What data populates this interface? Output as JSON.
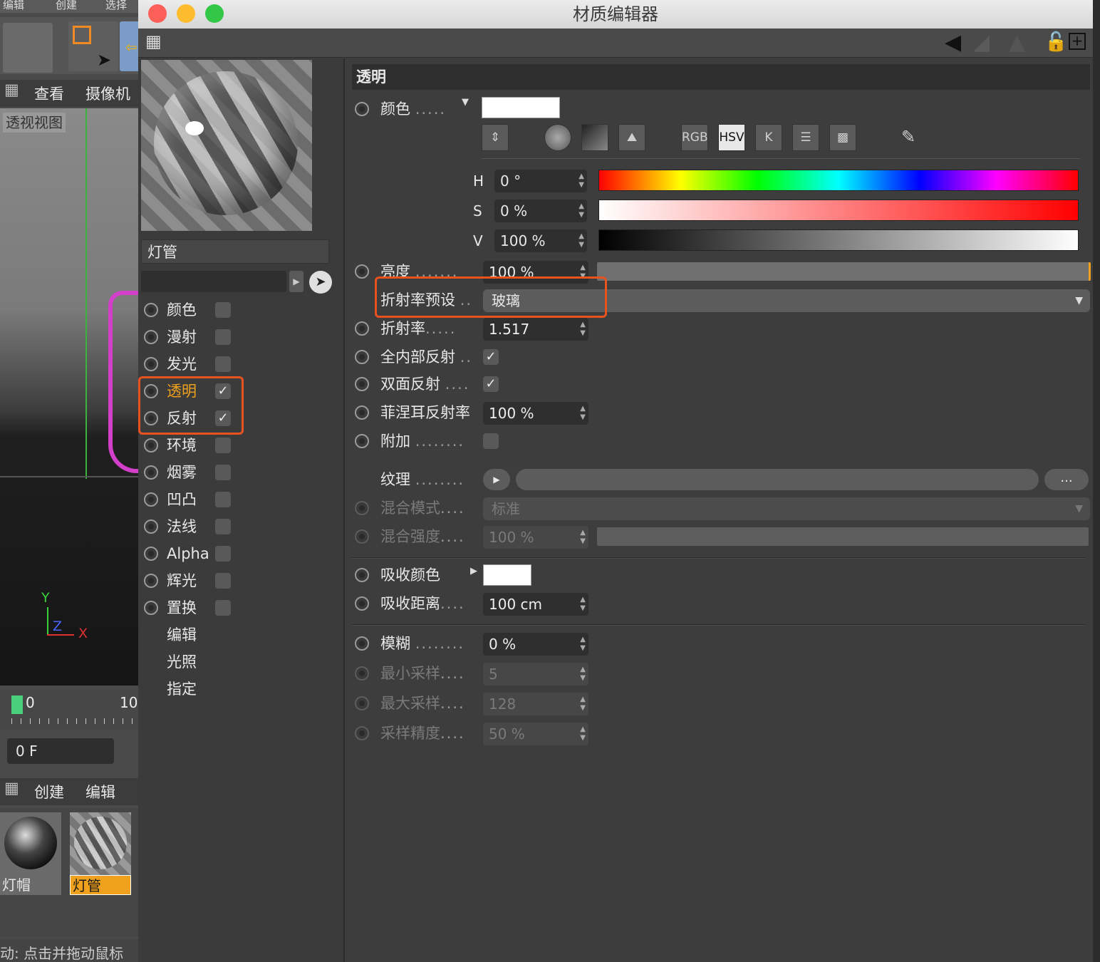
{
  "background_app": {
    "menu": [
      "编辑",
      "创建",
      "选择"
    ],
    "view_menu": [
      "查看",
      "摄像机"
    ],
    "viewport_label": "透视视图",
    "axis": {
      "y": "Y",
      "z": "Z",
      "x": "X"
    },
    "timeline": {
      "start": "0",
      "end": "10"
    },
    "frame_field": "0 F",
    "material_menu": [
      "创建",
      "编辑"
    ],
    "materials": [
      {
        "name": "灯帽",
        "selected": false
      },
      {
        "name": "灯管",
        "selected": true
      }
    ],
    "status_text": "动: 点击并拖动鼠标"
  },
  "window": {
    "title": "材质编辑器",
    "traffic_lights": [
      "#fc5f57",
      "#fdbc2e",
      "#33c748"
    ]
  },
  "left_panel": {
    "material_name": "灯管",
    "channels": [
      {
        "label": "颜色",
        "checked": false,
        "active": false
      },
      {
        "label": "漫射",
        "checked": false,
        "active": false
      },
      {
        "label": "发光",
        "checked": false,
        "active": false
      },
      {
        "label": "透明",
        "checked": true,
        "active": true
      },
      {
        "label": "反射",
        "checked": true,
        "active": false
      },
      {
        "label": "环境",
        "checked": false,
        "active": false
      },
      {
        "label": "烟雾",
        "checked": false,
        "active": false
      },
      {
        "label": "凹凸",
        "checked": false,
        "active": false
      },
      {
        "label": "法线",
        "checked": false,
        "active": false
      },
      {
        "label": "Alpha",
        "checked": false,
        "active": false
      },
      {
        "label": "辉光",
        "checked": false,
        "active": false
      },
      {
        "label": "置换",
        "checked": false,
        "active": false
      }
    ],
    "extra_items": [
      "编辑",
      "光照",
      "指定"
    ],
    "check_glyph": "✓"
  },
  "right_panel": {
    "section_title": "透明",
    "color": {
      "label": "颜色",
      "dots": ".....",
      "value_color": "#ffffff"
    },
    "color_mode_buttons": [
      "RGB",
      "HSV",
      "K"
    ],
    "hsv": [
      {
        "label": "H",
        "value": "0 °"
      },
      {
        "label": "S",
        "value": "0 %"
      },
      {
        "label": "V",
        "value": "100 %"
      }
    ],
    "brightness": {
      "label": "亮度",
      "dots": ".......",
      "value": "100 %"
    },
    "ior_preset": {
      "label": "折射率预设",
      "dots": "..",
      "value": "玻璃"
    },
    "ior": {
      "label": "折射率",
      "dots": ".....",
      "value": "1.517"
    },
    "total_internal": {
      "label": "全内部反射",
      "dots": "..",
      "checked": true
    },
    "double_sided": {
      "label": "双面反射",
      "dots": "....",
      "checked": true
    },
    "fresnel": {
      "label": "菲涅耳反射率",
      "value": "100 %"
    },
    "additive": {
      "label": "附加",
      "dots": "........",
      "checked": false
    },
    "texture": {
      "label": "纹理",
      "dots": "........",
      "more": "..."
    },
    "blend_mode": {
      "label": "混合模式",
      "dots": "....",
      "value": "标准"
    },
    "blend_strength": {
      "label": "混合强度",
      "dots": "....",
      "value": "100 %"
    },
    "absorption_color": {
      "label": "吸收颜色",
      "value_color": "#ffffff"
    },
    "absorption_distance": {
      "label": "吸收距离",
      "dots": "....",
      "value": "100 cm"
    },
    "blur": {
      "label": "模糊",
      "dots": "........",
      "value": "0 %"
    },
    "min_samples": {
      "label": "最小采样",
      "dots": "....",
      "value": "5"
    },
    "max_samples": {
      "label": "最大采样",
      "dots": "....",
      "value": "128"
    },
    "accuracy": {
      "label": "采样精度",
      "dots": "....",
      "value": "50 %"
    }
  },
  "highlight_color": "#e8521f"
}
